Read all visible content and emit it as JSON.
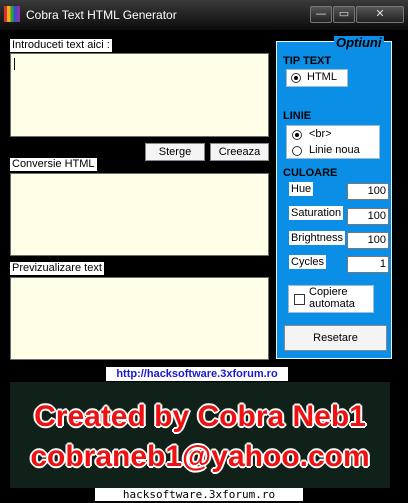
{
  "window": {
    "title": "Cobra Text HTML Generator",
    "controls": {
      "minimize": "—",
      "maximize": "▭",
      "close": "✕"
    }
  },
  "main": {
    "input_label": "Introduceti text aici :",
    "input_value": "",
    "clear_button": "Sterge",
    "create_button": "Creeaza",
    "conversion_label": "Conversie HTML",
    "conversion_value": "",
    "preview_label": "Previzualizare text",
    "preview_value": ""
  },
  "options": {
    "title": "Optiuni",
    "tip_text": {
      "title": "TIP TEXT",
      "options": [
        {
          "label": "HTML",
          "selected": true
        }
      ]
    },
    "linie": {
      "title": "LINIE",
      "options": [
        {
          "label": "<br>",
          "selected": true
        },
        {
          "label": "Linie noua",
          "selected": false
        }
      ]
    },
    "culoare": {
      "title": "CULOARE",
      "fields": [
        {
          "label": "Hue",
          "value": "100"
        },
        {
          "label": "Saturation",
          "value": "100"
        },
        {
          "label": "Brightness",
          "value": "100"
        },
        {
          "label": "Cycles",
          "value": "1"
        }
      ]
    },
    "auto_copy": {
      "line1": "Copiere",
      "line2": "automata",
      "checked": false
    },
    "reset_button": "Resetare"
  },
  "link": "http://hacksoftware.3xforum.ro",
  "banner": {
    "line1": "Created by Cobra Neb1",
    "line2": "cobraneb1@yahoo.com"
  },
  "footer": "hacksoftware.3xforum.ro",
  "colors": {
    "panel": "#0b8fe6",
    "banner_bg": "#0f2118",
    "banner_text": "#ee1111",
    "text_box": "#ffffe8",
    "link": "#1a1ad0"
  }
}
